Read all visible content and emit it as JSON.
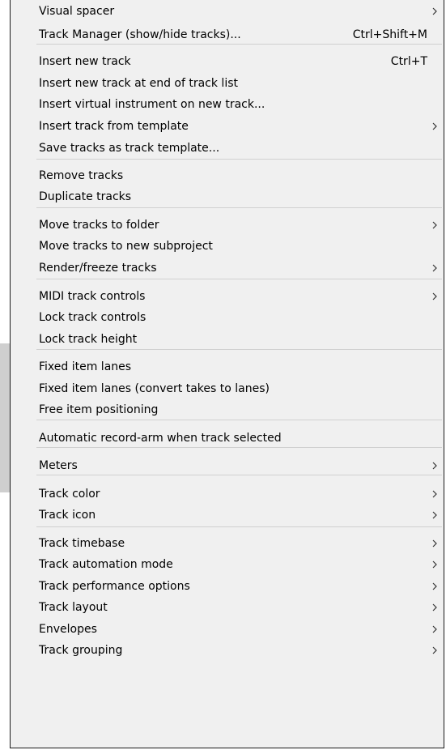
{
  "menu": {
    "items": [
      {
        "label": "Visual spacer",
        "shortcut": "",
        "submenu": true
      },
      {
        "label": "Track Manager (show/hide tracks)...",
        "shortcut": "Ctrl+Shift+M",
        "submenu": false
      },
      {
        "label": "Insert new track",
        "shortcut": "Ctrl+T",
        "submenu": false
      },
      {
        "label": "Insert new track at end of track list",
        "shortcut": "",
        "submenu": false
      },
      {
        "label": "Insert virtual instrument on new track...",
        "shortcut": "",
        "submenu": false
      },
      {
        "label": "Insert track from template",
        "shortcut": "",
        "submenu": true
      },
      {
        "label": "Save tracks as track template...",
        "shortcut": "",
        "submenu": false
      },
      {
        "label": "Remove tracks",
        "shortcut": "",
        "submenu": false
      },
      {
        "label": "Duplicate tracks",
        "shortcut": "",
        "submenu": false
      },
      {
        "label": "Move tracks to folder",
        "shortcut": "",
        "submenu": true
      },
      {
        "label": "Move tracks to new subproject",
        "shortcut": "",
        "submenu": false
      },
      {
        "label": "Render/freeze tracks",
        "shortcut": "",
        "submenu": true
      },
      {
        "label": "MIDI track controls",
        "shortcut": "",
        "submenu": true
      },
      {
        "label": "Lock track controls",
        "shortcut": "",
        "submenu": false
      },
      {
        "label": "Lock track height",
        "shortcut": "",
        "submenu": false
      },
      {
        "label": "Fixed item lanes",
        "shortcut": "",
        "submenu": false
      },
      {
        "label": "Fixed item lanes (convert takes to lanes)",
        "shortcut": "",
        "submenu": false
      },
      {
        "label": "Free item positioning",
        "shortcut": "",
        "submenu": false
      },
      {
        "label": "Automatic record-arm when track selected",
        "shortcut": "",
        "submenu": false
      },
      {
        "label": "Meters",
        "shortcut": "",
        "submenu": true
      },
      {
        "label": "Track color",
        "shortcut": "",
        "submenu": true
      },
      {
        "label": "Track icon",
        "shortcut": "",
        "submenu": true
      },
      {
        "label": "Track timebase",
        "shortcut": "",
        "submenu": true
      },
      {
        "label": "Track automation mode",
        "shortcut": "",
        "submenu": true
      },
      {
        "label": "Track performance options",
        "shortcut": "",
        "submenu": true
      },
      {
        "label": "Track layout",
        "shortcut": "",
        "submenu": true
      },
      {
        "label": "Envelopes",
        "shortcut": "",
        "submenu": true
      },
      {
        "label": "Track grouping",
        "shortcut": "",
        "submenu": true
      }
    ]
  },
  "colors": {
    "menu_background": "#f0f0f0",
    "separator": "#d0d0d0",
    "text": "#000000"
  }
}
